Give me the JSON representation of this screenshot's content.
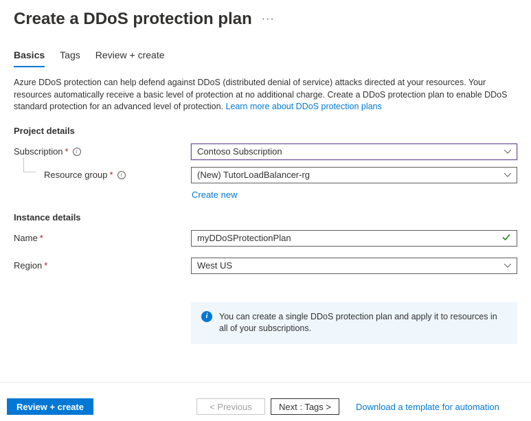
{
  "header": {
    "title": "Create a DDoS protection plan",
    "ellipsis": "···"
  },
  "tabs": [
    {
      "label": "Basics",
      "selected": true
    },
    {
      "label": "Tags",
      "selected": false
    },
    {
      "label": "Review + create",
      "selected": false
    }
  ],
  "description": {
    "text": "Azure DDoS protection can help defend against DDoS (distributed denial of service) attacks directed at your resources. Your resources automatically receive a basic level of protection at no additional charge. Create a DDoS protection plan to enable DDoS standard protection for an advanced level of protection.  ",
    "link": "Learn more about DDoS protection plans"
  },
  "sections": {
    "project_details": {
      "title": "Project details",
      "subscription": {
        "label": "Subscription",
        "value": "Contoso Subscription"
      },
      "resource_group": {
        "label": "Resource group",
        "value": "(New) TutorLoadBalancer-rg",
        "create_new": "Create new"
      }
    },
    "instance_details": {
      "title": "Instance details",
      "name": {
        "label": "Name",
        "value": "myDDoSProtectionPlan"
      },
      "region": {
        "label": "Region",
        "value": "West US"
      }
    }
  },
  "banner": {
    "text": "You can create a single DDoS protection plan and apply it to resources in all of your subscriptions."
  },
  "footer": {
    "review_create": "Review + create",
    "previous": "< Previous",
    "next": "Next : Tags >",
    "download_link": "Download a template for automation"
  }
}
